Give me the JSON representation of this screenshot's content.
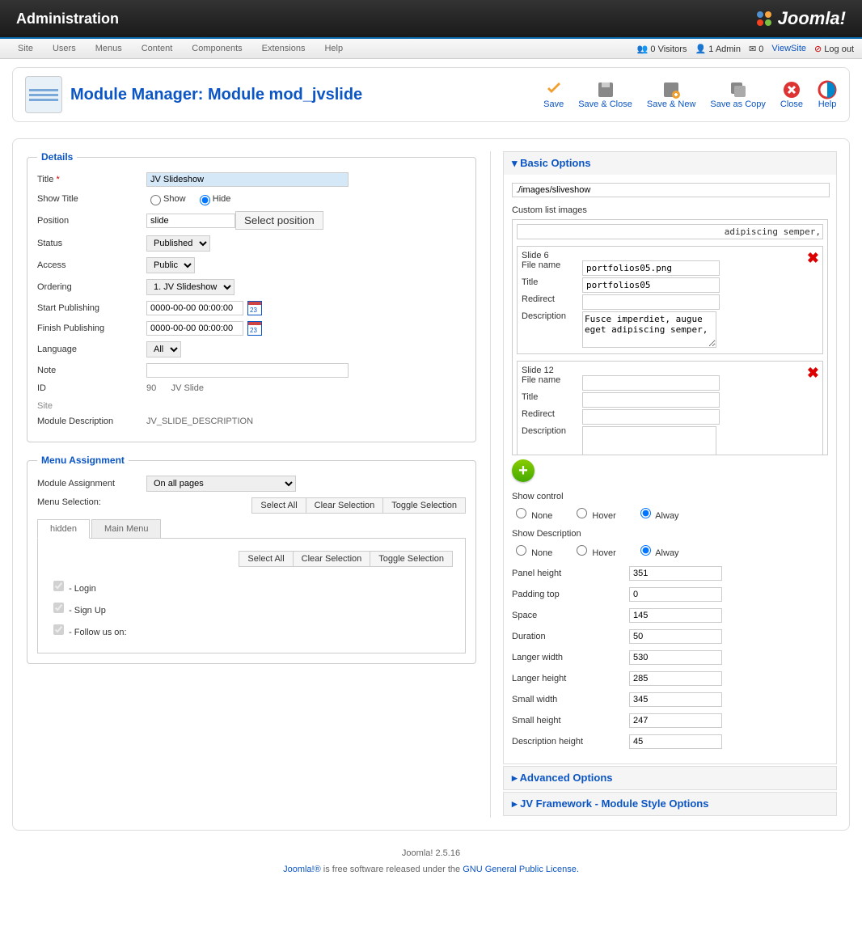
{
  "header": {
    "title": "Administration",
    "brand": "Joomla!"
  },
  "menu": {
    "items": [
      "Site",
      "Users",
      "Menus",
      "Content",
      "Components",
      "Extensions",
      "Help"
    ]
  },
  "status": {
    "visitors_n": "0",
    "visitors_l": "Visitors",
    "admin_n": "1",
    "admin_l": "Admin",
    "msg_n": "0",
    "viewsite": "ViewSite",
    "logout": "Log out"
  },
  "page": {
    "title": "Module Manager: Module mod_jvslide"
  },
  "toolbar": {
    "save": "Save",
    "save_close": "Save & Close",
    "save_new": "Save & New",
    "save_copy": "Save as Copy",
    "close": "Close",
    "help": "Help"
  },
  "details": {
    "legend": "Details",
    "title_label": "Title",
    "title_value": "JV Slideshow",
    "title_required": "*",
    "show_title_label": "Show Title",
    "show_opt": "Show",
    "hide_opt": "Hide",
    "position_label": "Position",
    "position_value": "slide",
    "select_position": "Select position",
    "status_label": "Status",
    "status_value": "Published",
    "access_label": "Access",
    "access_value": "Public",
    "ordering_label": "Ordering",
    "ordering_value": "1. JV Slideshow",
    "start_label": "Start Publishing",
    "start_value": "0000-00-00 00:00:00",
    "finish_label": "Finish Publishing",
    "finish_value": "0000-00-00 00:00:00",
    "language_label": "Language",
    "language_value": "All",
    "note_label": "Note",
    "note_value": "",
    "id_label": "ID",
    "id_value": "90",
    "module_type": "JV Slide",
    "site_label": "Site",
    "desc_label": "Module Description",
    "desc_value": "JV_SLIDE_DESCRIPTION"
  },
  "menuassign": {
    "legend": "Menu Assignment",
    "label": "Module Assignment",
    "value": "On all pages",
    "selection_label": "Menu Selection:",
    "select_all": "Select All",
    "clear": "Clear Selection",
    "toggle": "Toggle Selection",
    "tabs": [
      "hidden",
      "Main Menu"
    ],
    "items": [
      "- Login",
      "- Sign Up",
      "- Follow us on:"
    ]
  },
  "basic": {
    "title": "Basic Options",
    "path": "./images/sliveshow",
    "custom_label": "Custom list images",
    "frag_text": "adipiscing semper,",
    "slides": [
      {
        "header": "Slide 6",
        "filename": "portfolios05.png",
        "title": "portfolios05",
        "redirect": "",
        "description": "Fusce imperdiet, augue eget adipiscing semper,"
      },
      {
        "header": "Slide 12",
        "filename": "",
        "title": "",
        "redirect": "",
        "description": ""
      }
    ],
    "field_filename": "File name",
    "field_title": "Title",
    "field_redirect": "Redirect",
    "field_desc": "Description",
    "show_control_label": "Show control",
    "show_desc_label": "Show Description",
    "opt_none": "None",
    "opt_hover": "Hover",
    "opt_alway": "Alway",
    "params": [
      {
        "label": "Panel height",
        "value": "351"
      },
      {
        "label": "Padding top",
        "value": "0"
      },
      {
        "label": "Space",
        "value": "145"
      },
      {
        "label": "Duration",
        "value": "50"
      },
      {
        "label": "Langer width",
        "value": "530"
      },
      {
        "label": "Langer height",
        "value": "285"
      },
      {
        "label": "Small width",
        "value": "345"
      },
      {
        "label": "Small height",
        "value": "247"
      },
      {
        "label": "Description height",
        "value": "45"
      }
    ]
  },
  "panels": {
    "advanced": "Advanced Options",
    "framework": "JV Framework - Module Style Options"
  },
  "footer": {
    "version": "Joomla! 2.5.16",
    "text1": "Joomla!®",
    "text2": " is free software released under the ",
    "link": "GNU General Public License."
  }
}
